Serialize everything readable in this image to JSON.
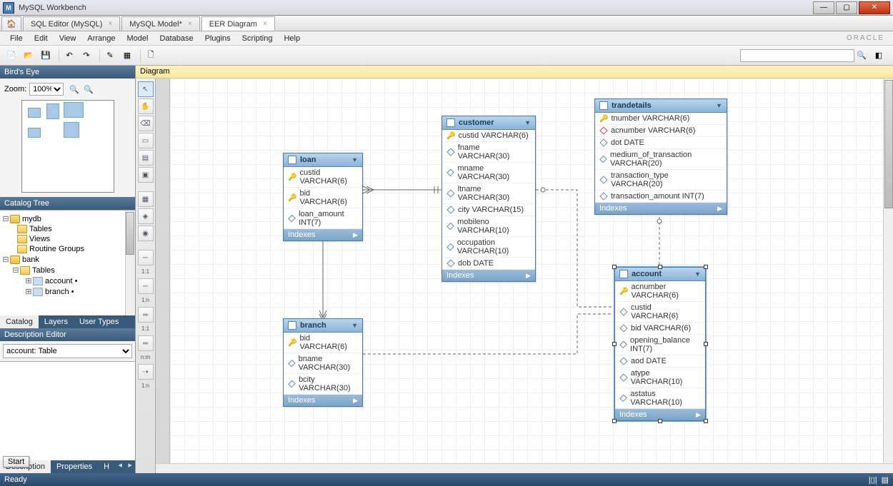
{
  "app": {
    "title": "MySQL Workbench"
  },
  "tabs": [
    {
      "label": "SQL Editor (MySQL)",
      "close": "×"
    },
    {
      "label": "MySQL Model*",
      "close": "×"
    },
    {
      "label": "EER Diagram",
      "close": "×",
      "active": true
    }
  ],
  "menu": [
    "File",
    "Edit",
    "View",
    "Arrange",
    "Model",
    "Database",
    "Plugins",
    "Scripting",
    "Help"
  ],
  "oracle_brand": "ORACLE",
  "panels": {
    "birdseye": {
      "title": "Bird's Eye",
      "zoom_label": "Zoom:",
      "zoom_value": "100%"
    },
    "catalog": {
      "title": "Catalog Tree",
      "nodes": {
        "mydb": "mydb",
        "tables": "Tables",
        "views": "Views",
        "routine_groups": "Routine Groups",
        "bank": "bank",
        "bank_tables": "Tables",
        "account": "account •",
        "branch": "branch •"
      },
      "bottom_tabs": [
        "Catalog",
        "Layers",
        "User Types"
      ]
    },
    "description": {
      "title": "Description Editor",
      "value": "account: Table",
      "bottom_tabs": [
        "Description",
        "Properties",
        "H"
      ]
    }
  },
  "canvas": {
    "title": "Diagram"
  },
  "tooldock_labels": {
    "r11": "1:1",
    "r1n": "1:n",
    "rr11": "1:1",
    "rnm": "n:m",
    "rr1n": "1:n"
  },
  "entities": {
    "loan": {
      "name": "loan",
      "cols": [
        {
          "k": true,
          "n": "custid VARCHAR(6)"
        },
        {
          "k": true,
          "n": "bid VARCHAR(6)"
        },
        {
          "d": true,
          "n": "loan_amount INT(7)"
        }
      ],
      "foot": "Indexes"
    },
    "branch": {
      "name": "branch",
      "cols": [
        {
          "k": true,
          "n": "bid VARCHAR(6)"
        },
        {
          "d": true,
          "n": "bname VARCHAR(30)"
        },
        {
          "d": true,
          "n": "bcity VARCHAR(30)"
        }
      ],
      "foot": "Indexes"
    },
    "customer": {
      "name": "customer",
      "cols": [
        {
          "k": true,
          "n": "custid VARCHAR(6)"
        },
        {
          "d": true,
          "n": "fname VARCHAR(30)"
        },
        {
          "d": true,
          "n": "mname VARCHAR(30)"
        },
        {
          "d": true,
          "n": "ltname VARCHAR(30)"
        },
        {
          "d": true,
          "n": "city VARCHAR(15)"
        },
        {
          "d": true,
          "n": "mobileno VARCHAR(10)"
        },
        {
          "d": true,
          "n": "occupation VARCHAR(10)"
        },
        {
          "d": true,
          "n": "dob DATE"
        }
      ],
      "foot": "Indexes"
    },
    "trandetails": {
      "name": "trandetails",
      "cols": [
        {
          "k": true,
          "n": "tnumber VARCHAR(6)"
        },
        {
          "d": true,
          "r": true,
          "n": "acnumber VARCHAR(6)"
        },
        {
          "d": true,
          "n": "dot DATE"
        },
        {
          "d": true,
          "n": "medium_of_transaction VARCHAR(20)"
        },
        {
          "d": true,
          "n": "transaction_type VARCHAR(20)"
        },
        {
          "d": true,
          "n": "transaction_amount INT(7)"
        }
      ],
      "foot": "Indexes"
    },
    "account": {
      "name": "account",
      "cols": [
        {
          "k": true,
          "n": "acnumber VARCHAR(6)"
        },
        {
          "d": true,
          "n": "custid VARCHAR(6)"
        },
        {
          "d": true,
          "n": "bid VARCHAR(6)"
        },
        {
          "d": true,
          "n": "opening_balance INT(7)"
        },
        {
          "d": true,
          "n": "aod DATE"
        },
        {
          "d": true,
          "n": "atype VARCHAR(10)"
        },
        {
          "d": true,
          "n": "astatus VARCHAR(10)"
        }
      ],
      "foot": "Indexes"
    }
  },
  "status": {
    "left": "Ready"
  },
  "start_btn": "Start",
  "chart_data": {
    "type": "erd",
    "note": "Entity-Relationship diagram; tables and columns captured under 'entities'; relationships listed below",
    "tables": [
      "loan",
      "branch",
      "customer",
      "trandetails",
      "account"
    ],
    "relationships": [
      {
        "from": "loan",
        "to": "customer",
        "style": "identifying",
        "notation": "many-to-one"
      },
      {
        "from": "loan",
        "to": "branch",
        "style": "identifying",
        "notation": "many-to-one"
      },
      {
        "from": "account",
        "to": "customer",
        "style": "non-identifying",
        "notation": "many-to-one"
      },
      {
        "from": "account",
        "to": "branch",
        "style": "non-identifying",
        "notation": "many-to-one"
      },
      {
        "from": "trandetails",
        "to": "account",
        "style": "non-identifying",
        "notation": "many-to-one"
      }
    ]
  }
}
